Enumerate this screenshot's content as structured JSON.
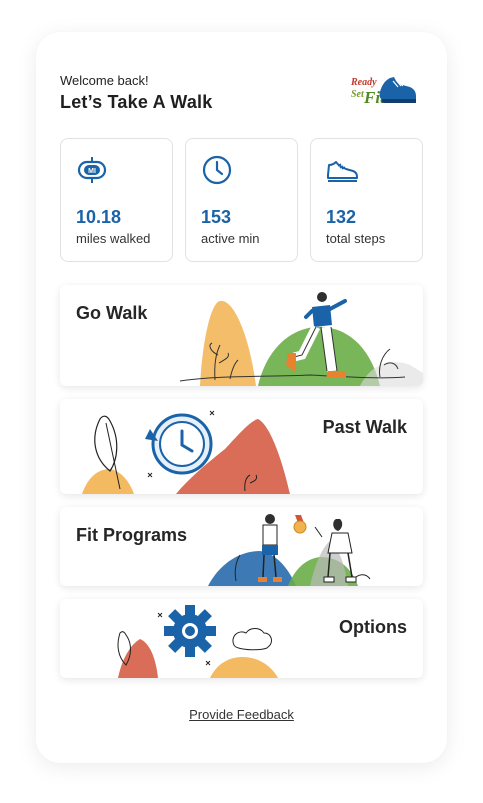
{
  "header": {
    "welcome": "Welcome back!",
    "headline": "Let’s Take A Walk",
    "logo": {
      "line1": "Ready",
      "line2": "Set",
      "line3": "Fit",
      "icon": "sneaker-icon"
    }
  },
  "stats": [
    {
      "icon": "mile-marker-icon",
      "icon_text": "MI",
      "value": "10.18",
      "label": "miles walked"
    },
    {
      "icon": "clock-icon",
      "value": "153",
      "label": "active min"
    },
    {
      "icon": "sneaker-icon",
      "value": "132",
      "label": "total steps"
    }
  ],
  "cards": {
    "go_walk": "Go Walk",
    "past_walk": "Past Walk",
    "fit_programs": "Fit Programs",
    "options": "Options"
  },
  "footer": {
    "feedback": "Provide Feedback"
  },
  "colors": {
    "accent_blue": "#1b63a8",
    "orange": "#f0a640",
    "green": "#6aad47",
    "red": "#d4543a"
  }
}
